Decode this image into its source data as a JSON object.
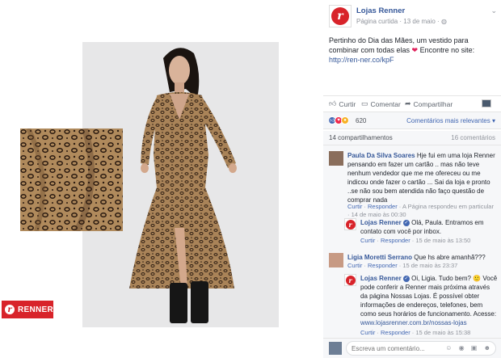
{
  "photo": {
    "brand_logo_text": "RENNER",
    "colors": {
      "brand_red": "#d8232a",
      "studio_bg": "#e7e7e8"
    }
  },
  "post": {
    "page_name": "Lojas Renner",
    "meta": "Página curtida · 13 de maio · ",
    "text_line1": "Pertinho do Dia das Mães, um vestido para combinar com todas elas ",
    "text_line2": " Encontre no site: ",
    "link": "http://ren-ner.co/kpF",
    "heart_icon": "red-heart-icon"
  },
  "actions": {
    "like": "Curtir",
    "comment": "Comentar",
    "share": "Compartilhar"
  },
  "reactions": {
    "count": "620",
    "sort_label": "Comentários mais relevantes ▾"
  },
  "stats": {
    "shares": "14 compartilhamentos",
    "comments": "16 comentários"
  },
  "comments": [
    {
      "name": "Paula Da Silva Soares",
      "text": "Hje fui em uma loja Renner pensando em fazer um cartão .. mas não teve nenhum vendedor que me me ofereceu ou me indicou onde fazer o cartão ... Sai da loja e pronto ..se não sou bem atendida não faço questão de comprar nada",
      "meta_like": "Curtir",
      "meta_reply": "Responder",
      "meta_tail": " · A Página respondeu em particular · 14 de maio às 00:30"
    },
    {
      "name": "Lojas Renner",
      "text": "Olá, Paula. Entramos em contato com você por inbox.",
      "meta_like": "Curtir",
      "meta_reply": "Responder",
      "meta_tail": " · 15 de maio às 13:50"
    },
    {
      "name": "Ligia Moretti Serrano",
      "text": "Que hs abre amanhã???",
      "meta_like": "Curtir",
      "meta_reply": "Responder",
      "meta_tail": " · 15 de maio às 23:37"
    },
    {
      "name": "Lojas Renner",
      "text": "Oi, Ligia. Tudo bem? 🙂 Você pode conferir a Renner mais próxima através da página Nossas Lojas. É possível obter informações de endereços, telefones, bem como seus horários de funcionamento. Acesse:",
      "link": "www.lojasrenner.com.br/nossas-lojas",
      "meta_like": "Curtir",
      "meta_reply": "Responder",
      "meta_tail": " · 15 de maio às 15:38"
    }
  ],
  "composer": {
    "placeholder": "Escreva um comentário...",
    "tools": "☺ ◉ ▣ ☻"
  }
}
